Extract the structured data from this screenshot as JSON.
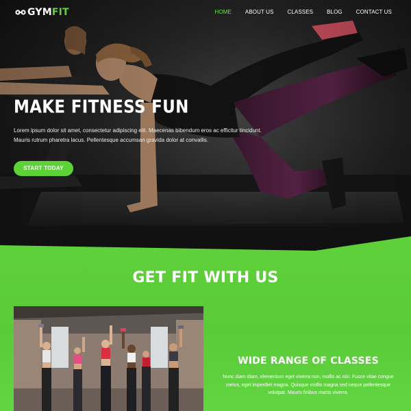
{
  "header": {
    "logo_prefix": "GYM",
    "logo_accent": "FIT",
    "nav": [
      {
        "label": "HOME",
        "active": true
      },
      {
        "label": "ABOUT US",
        "active": false
      },
      {
        "label": "CLASSES",
        "active": false
      },
      {
        "label": "BLOG",
        "active": false
      },
      {
        "label": "CONTACT US",
        "active": false
      }
    ]
  },
  "hero": {
    "title": "MAKE FITNESS FUN",
    "text": "Lorem ipsum dolor sit amet, consectetur adipiscing elit. Maecenas bibendum eros ac efficitur tincidunt. Mauris rutrum pharetra lacus. Pellentesque accumsan gravida dolor at convallis.",
    "cta_label": "START TODAY"
  },
  "section": {
    "title": "GET FIT WITH US",
    "feature_title": "WIDE RANGE OF CLASSES",
    "feature_text": "Nunc diam diam, elementum eget viverra non, mollis ac nisi. Fusce vitae congue metus, eget imperdiet magna. Quisque mollis magna sed neque pellentesque volutpat. Mauris finibus mattis viverra."
  },
  "colors": {
    "accent": "#5fd33f",
    "nav_active": "#6ee04a",
    "section_bg": "#5acb38",
    "hero_bg": "#1e1e1e"
  },
  "icons": {
    "logo": "dumbbell-icon"
  }
}
